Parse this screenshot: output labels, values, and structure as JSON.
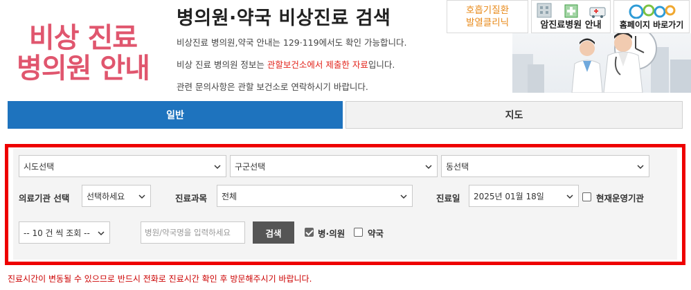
{
  "logo": {
    "line1": "비상 진료",
    "line2": "병의원 안내"
  },
  "header": {
    "title": "병의원·약국 비상진료 검색",
    "info1": "비상진료 병의원,약국 안내는 129·119에서도 확인 가능합니다.",
    "info2_before": "비상 진료 병의원 정보는 ",
    "info2_highlight": "관할보건소에서 제출한 자료",
    "info2_after": "입니다.",
    "info3": "관련 문의사항은 관할 보건소로 연락하시기 바랍니다."
  },
  "banners": {
    "respiratory_line1": "호흡기질환",
    "respiratory_line2": "발열클리닉",
    "cancer": "암진료병원 안내",
    "homepage": "홈페이지 바로가기"
  },
  "tabs": {
    "general": "일반",
    "map": "지도"
  },
  "filters": {
    "sido": "시도선택",
    "gugun": "구군선택",
    "dong": "동선택",
    "institution_label": "의료기관 선택",
    "institution_value": "선택하세요",
    "department_label": "진료과목",
    "department_value": "전체",
    "date_label": "진료일",
    "date_value": "2025년 01월 18일",
    "operating_label": "현재운영기관",
    "page_size": "-- 10 건 씩 조회 --",
    "name_placeholder": "병원/약국명을 입력하세요",
    "search_button": "검색",
    "hospital_label": "병·의원",
    "pharmacy_label": "약국",
    "operating_checked": false,
    "hospital_checked": true,
    "pharmacy_checked": false
  },
  "notice": "진료시간이 변동될 수 있으므로 반드시 전화로 진료시간 확인 후 방문해주시기 바랍니다.",
  "colors": {
    "accent_blue": "#1e73be",
    "highlight_red": "#e2231a",
    "frame_red": "#ee0000",
    "logo_pink": "#e0566e"
  }
}
